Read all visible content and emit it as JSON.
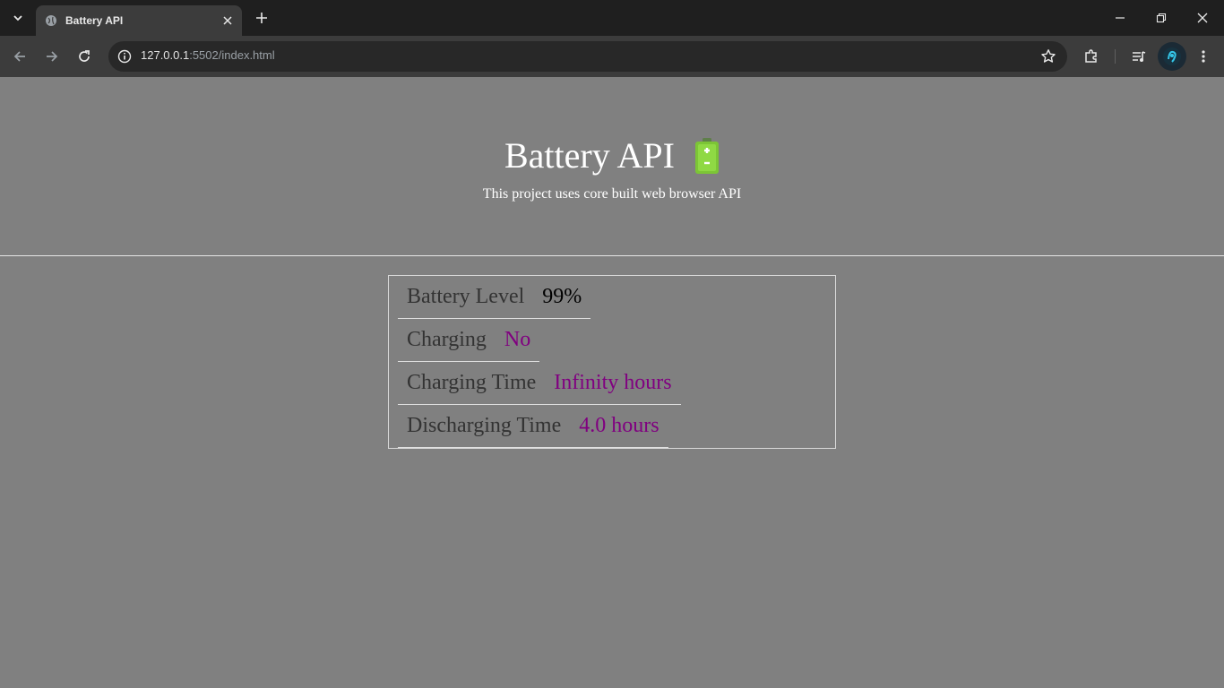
{
  "browser": {
    "tab_title": "Battery API",
    "url_host": "127.0.0.1",
    "url_rest": ":5502/index.html"
  },
  "page": {
    "title": "Battery API",
    "subtitle": "This project uses core built web browser API",
    "battery_icon": "battery-emoji-icon"
  },
  "stats": [
    {
      "label": "Battery Level",
      "value": "99%",
      "color": "#000000"
    },
    {
      "label": "Charging",
      "value": "No",
      "color": "#800080"
    },
    {
      "label": "Charging Time",
      "value": "Infinity hours",
      "color": "#800080"
    },
    {
      "label": "Discharging Time",
      "value": "4.0 hours",
      "color": "#800080"
    }
  ],
  "colors": {
    "page_bg": "#808080",
    "accent_value": "#800080"
  }
}
